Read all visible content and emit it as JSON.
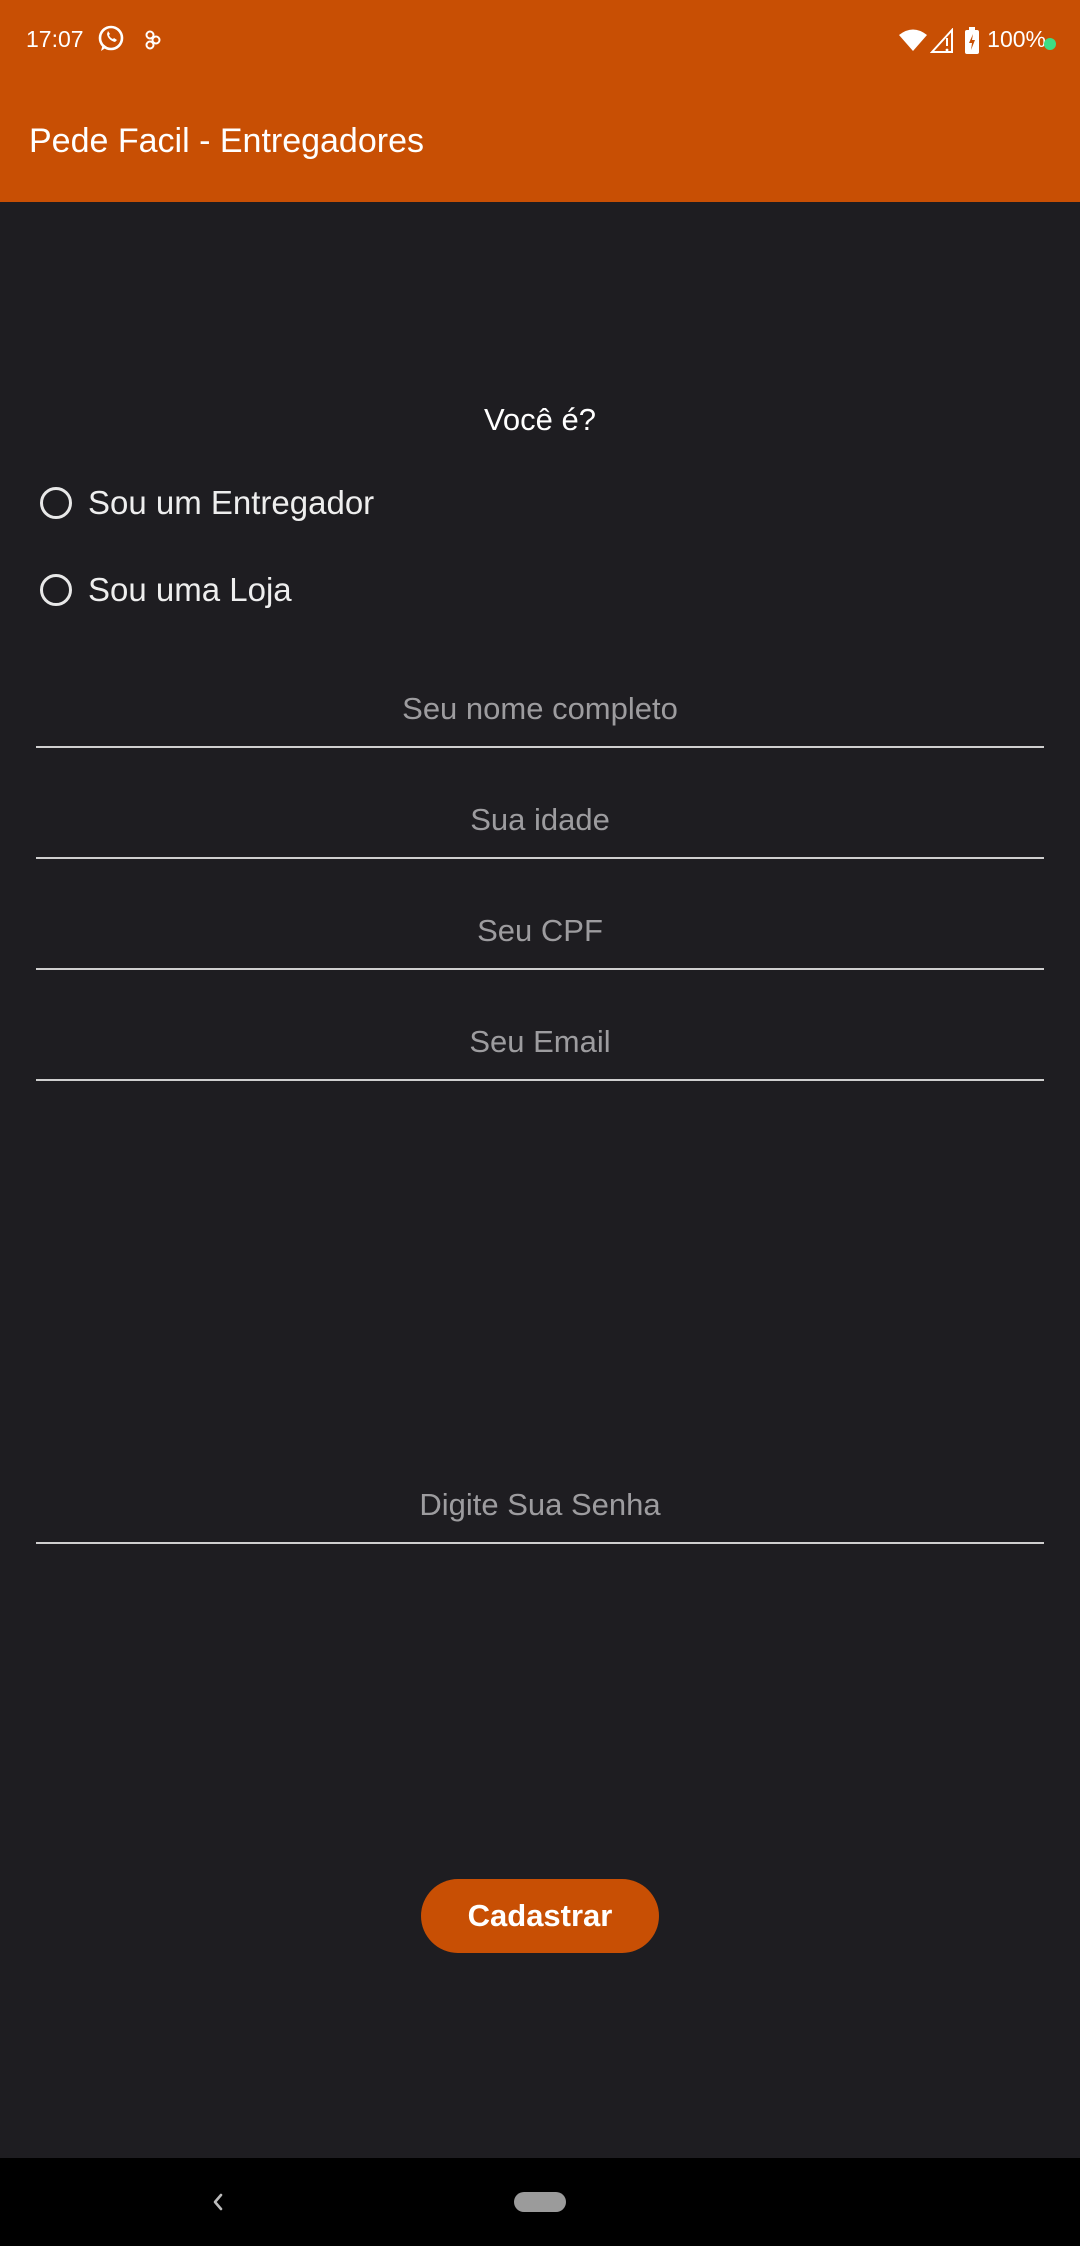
{
  "status_bar": {
    "time": "17:07",
    "battery": "100%",
    "icons": [
      "whatsapp-icon",
      "notification-icon",
      "wifi-icon",
      "signal-icon",
      "battery-icon"
    ],
    "battery_dot_color": "#3ddc84"
  },
  "app_bar": {
    "title": "Pede Facil - Entregadores",
    "color": "#c84f04"
  },
  "form": {
    "question": "Você é?",
    "options": [
      {
        "label": "Sou um Entregador",
        "selected": false
      },
      {
        "label": "Sou uma Loja",
        "selected": false
      }
    ],
    "fields": {
      "name_placeholder": "Seu nome completo",
      "age_placeholder": "Sua idade",
      "cpf_placeholder": "Seu CPF",
      "email_placeholder": "Seu Email",
      "password_placeholder": "Digite Sua Senha"
    },
    "submit_label": "Cadastrar"
  },
  "nav_bar": {
    "icons": [
      "back-icon",
      "home-pill-icon"
    ]
  }
}
